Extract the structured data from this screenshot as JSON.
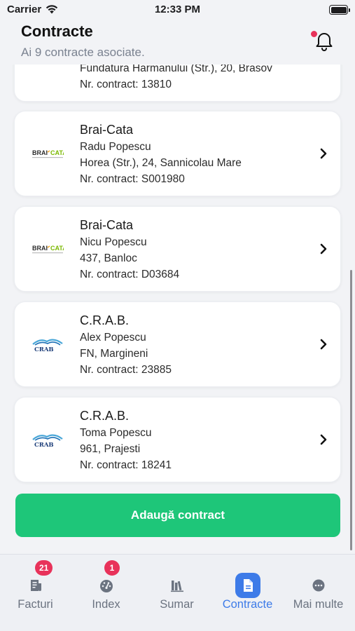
{
  "status": {
    "carrier": "Carrier",
    "time": "12:33 PM"
  },
  "header": {
    "title": "Contracte",
    "subtitle": "Ai 9 contracte asociate."
  },
  "contracts": [
    {
      "name": "",
      "person": "",
      "address": "Fundatura Harmanului (Str.), 20, Brasov",
      "number": "Nr. contract: 13810",
      "logo": "none"
    },
    {
      "name": "Brai-Cata",
      "person": "Radu Popescu",
      "address": "Horea (Str.), 24, Sannicolau Mare",
      "number": "Nr. contract: S001980",
      "logo": "brai-cata-logo"
    },
    {
      "name": "Brai-Cata",
      "person": "Nicu Popescu",
      "address": "437, Banloc",
      "number": "Nr. contract: D03684",
      "logo": "brai-cata-logo"
    },
    {
      "name": "C.R.A.B.",
      "person": "Alex Popescu",
      "address": "FN, Margineni",
      "number": "Nr. contract: 23885",
      "logo": "crab-logo"
    },
    {
      "name": "C.R.A.B.",
      "person": "Toma Popescu",
      "address": "961, Prajesti",
      "number": "Nr. contract: 18241",
      "logo": "crab-logo"
    }
  ],
  "add_button": "Adaugă contract",
  "tabs": [
    {
      "label": "Facturi",
      "icon": "invoice-icon",
      "badge": "21"
    },
    {
      "label": "Index",
      "icon": "gauge-icon",
      "badge": "1"
    },
    {
      "label": "Sumar",
      "icon": "summary-icon"
    },
    {
      "label": "Contracte",
      "icon": "document-icon",
      "active": true
    },
    {
      "label": "Mai multe",
      "icon": "more-icon"
    }
  ],
  "colors": {
    "accent": "#3d7be8",
    "primary_button": "#1ec679",
    "badge": "#e8325a"
  }
}
